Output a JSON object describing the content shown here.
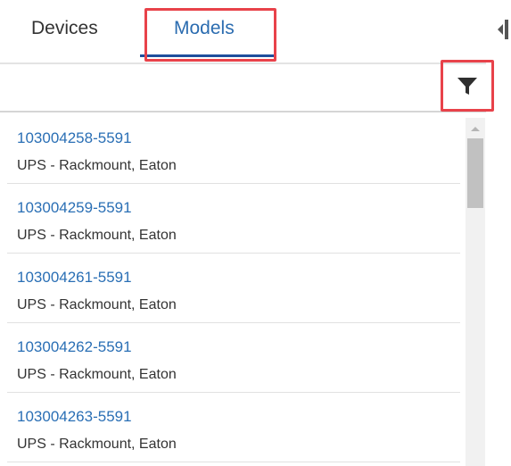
{
  "tabs": [
    {
      "label": "Devices",
      "active": false
    },
    {
      "label": "Models",
      "active": true
    }
  ],
  "toolbar": {
    "filter_icon": "filter-icon"
  },
  "colors": {
    "accent": "#2b6cb0",
    "highlight": "#e8424a",
    "link": "#2a6fb5"
  },
  "models": [
    {
      "id": "103004258-5591",
      "description": "UPS - Rackmount, Eaton"
    },
    {
      "id": "103004259-5591",
      "description": "UPS - Rackmount, Eaton"
    },
    {
      "id": "103004261-5591",
      "description": "UPS - Rackmount, Eaton"
    },
    {
      "id": "103004262-5591",
      "description": "UPS - Rackmount, Eaton"
    },
    {
      "id": "103004263-5591",
      "description": "UPS - Rackmount, Eaton"
    }
  ]
}
